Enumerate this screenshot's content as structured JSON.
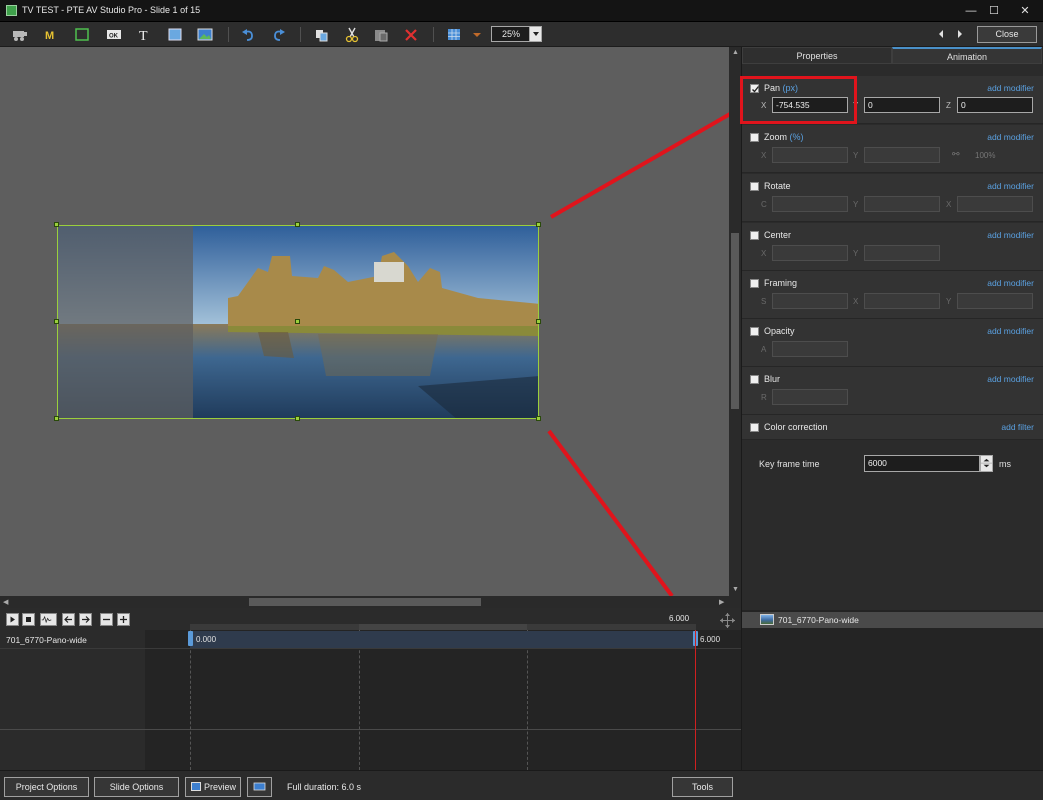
{
  "window": {
    "title": "TV TEST - PTE AV Studio Pro - Slide 1 of 15",
    "minimize_glyph": "—",
    "maximize_glyph": "☐",
    "close_glyph": "✕"
  },
  "toolbar": {
    "icons": [
      "slideshow-icon",
      "mask-icon",
      "frame-icon",
      "ok-icon",
      "text-icon",
      "rectangle-icon",
      "image-icon",
      "undo-icon",
      "redo-icon",
      "copy-icon",
      "cut-icon",
      "paste-icon",
      "delete-icon",
      "grid-icon",
      "grid-dropdown-icon"
    ],
    "zoom": "25%",
    "close_label": "Close"
  },
  "panel": {
    "tabs": [
      "Properties",
      "Animation"
    ],
    "active_tab": "Animation",
    "pan": {
      "label": "Pan",
      "unit": "(px)",
      "checked": true,
      "add": "add modifier",
      "axes": [
        "X",
        "Y",
        "Z"
      ],
      "x": "-754.535",
      "y": "0",
      "z": "0"
    },
    "zoom": {
      "label": "Zoom",
      "unit": "(%)",
      "add": "add modifier",
      "axes": [
        "X",
        "Y"
      ],
      "percent": "100%"
    },
    "rotate": {
      "label": "Rotate",
      "add": "add modifier",
      "axes": [
        "C",
        "Y",
        "X"
      ]
    },
    "center": {
      "label": "Center",
      "add": "add modifier",
      "axes": [
        "X",
        "Y"
      ]
    },
    "framing": {
      "label": "Framing",
      "add": "add modifier",
      "axes": [
        "S",
        "X",
        "Y"
      ]
    },
    "opacity": {
      "label": "Opacity",
      "add": "add modifier",
      "axes": [
        "A"
      ]
    },
    "blur": {
      "label": "Blur",
      "add": "add modifier",
      "axes": [
        "R"
      ]
    },
    "color_correction": {
      "label": "Color correction",
      "add": "add filter"
    },
    "keyframe_time": {
      "label": "Key frame time",
      "value": "6000",
      "unit": "ms"
    }
  },
  "timeline": {
    "ruler_end": "6.000",
    "track_name": "701_6770-Pano-wide",
    "keyframe_start": "0.000",
    "keyframe_end": "6.000"
  },
  "object_list": {
    "items": [
      "701_6770-Pano-wide"
    ]
  },
  "bottom": {
    "project_options": "Project Options",
    "slide_options": "Slide Options",
    "preview": "Preview",
    "duration": "Full duration: 6.0 s",
    "tools": "Tools"
  },
  "colors": {
    "accent": "#5aa0e0",
    "highlight_red": "#e0141c",
    "selection_green": "#9bcf3c",
    "keyframe_blue": "#5b9ad9"
  }
}
